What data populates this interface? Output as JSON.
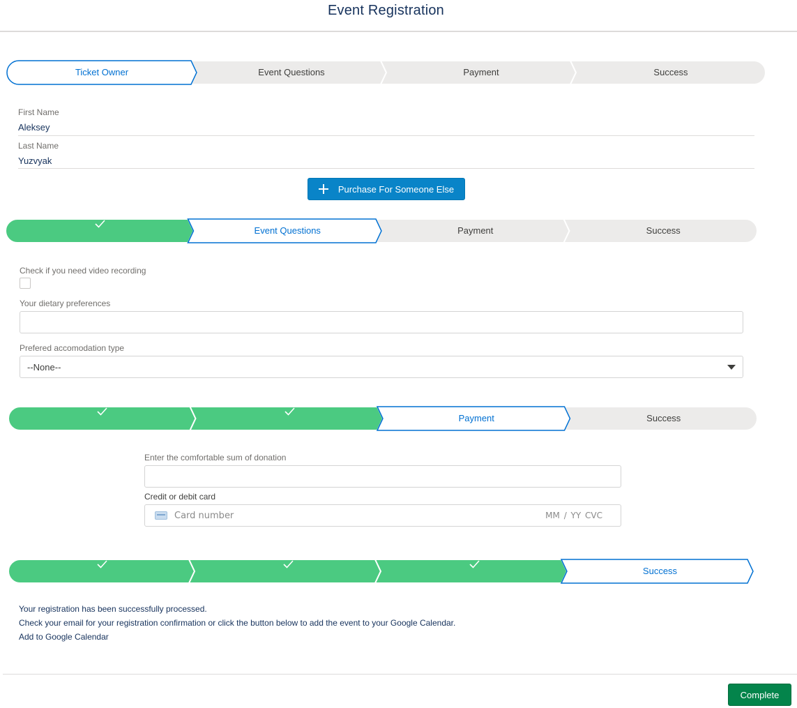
{
  "page": {
    "title": "Event Registration"
  },
  "colors": {
    "complete": "#4bca81",
    "current_border": "#0070d2",
    "incomplete": "#ecebea",
    "primary_button": "#0984c8",
    "success_button": "#04844b"
  },
  "paths": [
    {
      "stages": [
        {
          "label": "Ticket Owner",
          "status": "current"
        },
        {
          "label": "Event Questions",
          "status": "incomplete"
        },
        {
          "label": "Payment",
          "status": "incomplete"
        },
        {
          "label": "Success",
          "status": "incomplete"
        }
      ]
    },
    {
      "stages": [
        {
          "label": "",
          "status": "complete"
        },
        {
          "label": "Event Questions",
          "status": "current"
        },
        {
          "label": "Payment",
          "status": "incomplete"
        },
        {
          "label": "Success",
          "status": "incomplete"
        }
      ]
    },
    {
      "stages": [
        {
          "label": "",
          "status": "complete"
        },
        {
          "label": "",
          "status": "complete"
        },
        {
          "label": "Payment",
          "status": "current"
        },
        {
          "label": "Success",
          "status": "incomplete"
        }
      ]
    },
    {
      "stages": [
        {
          "label": "",
          "status": "complete"
        },
        {
          "label": "",
          "status": "complete"
        },
        {
          "label": "",
          "status": "complete"
        },
        {
          "label": "Success",
          "status": "current"
        }
      ]
    }
  ],
  "ticket_owner": {
    "first_name_label": "First Name",
    "first_name_value": "Aleksey",
    "last_name_label": "Last Name",
    "last_name_value": "Yuzvyak",
    "purchase_button_label": "Purchase For Someone Else"
  },
  "event_questions": {
    "video_label": "Check if you need video recording",
    "video_checked": false,
    "dietary_label": "Your dietary preferences",
    "dietary_value": "",
    "accommodation_label": "Prefered accomodation type",
    "accommodation_value": "--None--"
  },
  "payment": {
    "donation_label": "Enter the comfortable sum of donation",
    "donation_value": "",
    "card_label": "Credit or debit card",
    "card_placeholder": "Card number",
    "card_expiry_placeholder": "MM / YY  CVC",
    "card_icon": "credit-card-icon"
  },
  "success": {
    "line1": "Your registration has been successfully processed.",
    "line2": "Check your email for your registration confirmation or click the button below to add the event to your Google Calendar.",
    "calendar_link": "Add to Google Calendar"
  },
  "footer": {
    "complete_label": "Complete"
  }
}
